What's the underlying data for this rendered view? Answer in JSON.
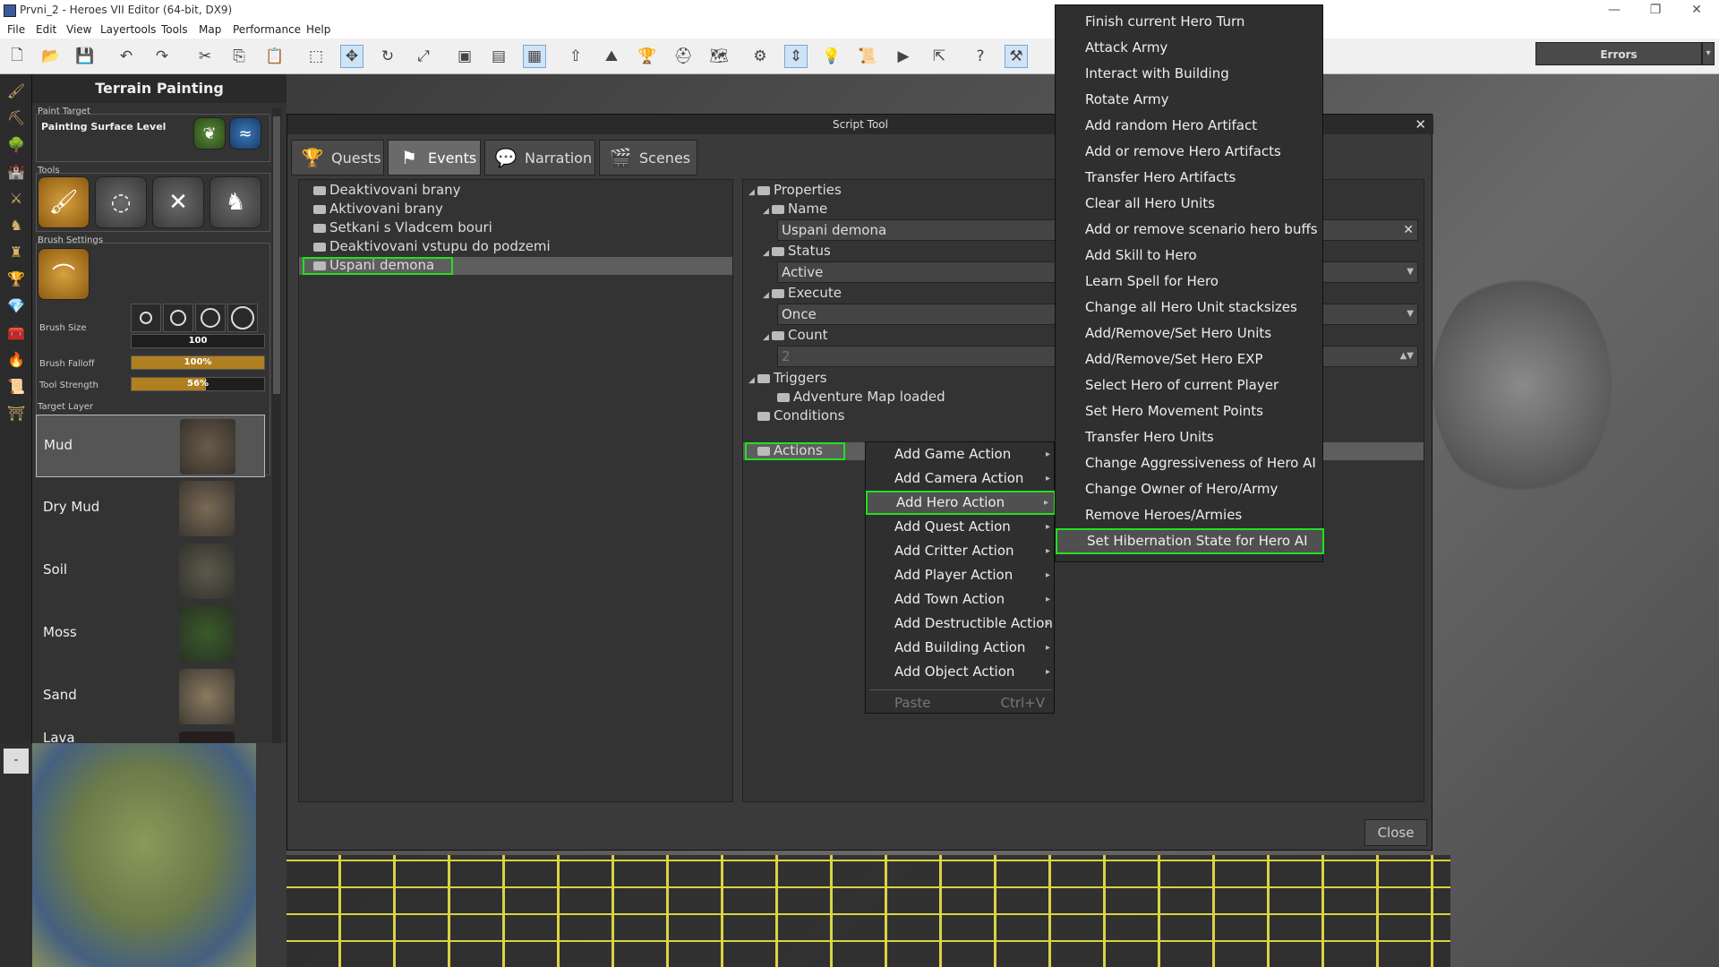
{
  "window": {
    "title": "Prvni_2 - Heroes VII Editor (64-bit, DX9)",
    "minimize": "—",
    "restore": "❐",
    "close": "✕"
  },
  "menu": [
    "File",
    "Edit",
    "View",
    "Layertools",
    "Tools",
    "Map",
    "Performance",
    "Help"
  ],
  "toolbar": {
    "icons": [
      "new-file-icon",
      "open-folder-icon",
      "save-icon",
      "undo-icon",
      "redo-icon",
      "cut-icon",
      "copy-icon",
      "paste-icon",
      "select-icon",
      "move-icon",
      "rotate-icon",
      "scale-icon",
      "render-icon",
      "2d-view-icon",
      "grid-icon",
      "cursor-icon",
      "terrain-icon",
      "trophy-icon",
      "helmet-icon",
      "map-icon",
      "gear-icon",
      "transform-icon",
      "light-icon",
      "script-icon",
      "play-icon",
      "export-icon",
      "help-icon",
      "toolkit-icon"
    ],
    "errors_label": "Errors"
  },
  "terrain_panel": {
    "title": "Terrain Painting",
    "paint_target_label": "Paint Target",
    "paint_target_value": "Painting Surface Level",
    "tools_label": "Tools",
    "brush_settings_label": "Brush Settings",
    "brush_size_label": "Brush Size",
    "brush_size_value": "100",
    "brush_falloff_label": "Brush Falloff",
    "brush_falloff_value": "100%",
    "brush_falloff_fraction": 1.0,
    "tool_strength_label": "Tool Strength",
    "tool_strength_value": "56%",
    "tool_strength_fraction": 0.56,
    "target_layer_label": "Target Layer",
    "layers": [
      "Mud",
      "Dry Mud",
      "Soil",
      "Moss",
      "Sand",
      "Lava"
    ],
    "layer_colors": [
      "#6a5a48",
      "#7a6a55",
      "#5a5a4a",
      "#3a5a2a",
      "#8a7a60",
      "#2a1a1a"
    ]
  },
  "minimap": {
    "toggle": "-"
  },
  "script_tool": {
    "title": "Script Tool",
    "close_x": "✕",
    "tabs": [
      "Quests",
      "Events",
      "Narration",
      "Scenes"
    ],
    "events": [
      "Deaktivovani brany",
      "Aktivovani brany",
      "Setkani s Vladcem bouri",
      "Deaktivovani vstupu do podzemi",
      "Uspani demona"
    ],
    "props": {
      "properties": "Properties",
      "name_label": "Name",
      "name_value": "Uspani demona",
      "clear_x": "✕",
      "status_label": "Status",
      "status_value": "Active",
      "execute_label": "Execute",
      "execute_value": "Once",
      "count_label": "Count",
      "count_value": "2",
      "triggers_label": "Triggers",
      "trigger_item": "Adventure Map loaded",
      "conditions_label": "Conditions",
      "actions_label": "Actions"
    },
    "close_button": "Close"
  },
  "context_menu": {
    "items": [
      "Add Game Action",
      "Add Camera Action",
      "Add Hero Action",
      "Add Quest Action",
      "Add Critter Action",
      "Add Player Action",
      "Add Town Action",
      "Add Destructible Action",
      "Add Building Action",
      "Add Object Action"
    ],
    "paste_label": "Paste",
    "paste_shortcut": "Ctrl+V"
  },
  "hero_submenu": {
    "items": [
      "Finish current Hero Turn",
      "Attack Army",
      "Interact with Building",
      "Rotate Army",
      "Add random Hero Artifact",
      "Add or remove Hero Artifacts",
      "Transfer Hero Artifacts",
      "Clear all Hero Units",
      "Add or remove scenario hero buffs",
      "Add Skill to Hero",
      "Learn Spell for Hero",
      "Change all Hero Unit stacksizes",
      "Add/Remove/Set Hero Units",
      "Add/Remove/Set Hero EXP",
      "Select Hero of current Player",
      "Set Hero Movement Points",
      "Transfer Hero Units",
      "Change Aggressiveness of Hero AI",
      "Change Owner of Hero/Army",
      "Remove Heroes/Armies",
      "Set Hibernation State for Hero AI"
    ]
  },
  "colors": {
    "highlight": "#22e022",
    "accent_gold": "#b08020"
  }
}
